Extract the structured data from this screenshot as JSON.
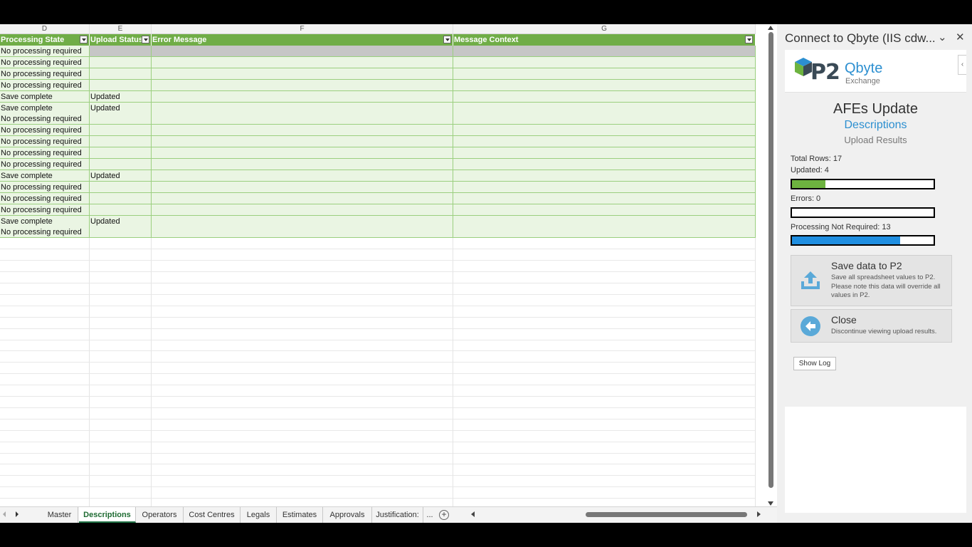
{
  "columns": [
    {
      "letter": "D",
      "header": "Processing State"
    },
    {
      "letter": "E",
      "header": "Upload Status"
    },
    {
      "letter": "F",
      "header": "Error Message"
    },
    {
      "letter": "G",
      "header": "Message Context"
    }
  ],
  "rows": [
    [
      "No processing required",
      ""
    ],
    [
      "No processing required",
      ""
    ],
    [
      "No processing required",
      ""
    ],
    [
      "No processing required",
      ""
    ],
    [
      "Save complete",
      "Updated"
    ],
    [
      "Save complete",
      "Updated"
    ],
    [
      "No processing required",
      ""
    ],
    [
      "No processing required",
      ""
    ],
    [
      "No processing required",
      ""
    ],
    [
      "No processing required",
      ""
    ],
    [
      "No processing required",
      ""
    ],
    [
      "Save complete",
      "Updated"
    ],
    [
      "No processing required",
      ""
    ],
    [
      "No processing required",
      ""
    ],
    [
      "No processing required",
      ""
    ],
    [
      "Save complete",
      "Updated"
    ],
    [
      "No processing required",
      ""
    ]
  ],
  "tabs": [
    "Master",
    "Descriptions",
    "Operators",
    "Cost Centres",
    "Legals",
    "Estimates",
    "Approvals",
    "Justification:",
    "..."
  ],
  "active_tab": "Descriptions",
  "pane": {
    "title": "Connect to Qbyte (IIS cdw...",
    "logo_p2": "P2",
    "logo_qbyte": "Qbyte",
    "logo_exchange": "Exchange",
    "heading": "AFEs Update",
    "subheading": "Descriptions",
    "section": "Upload Results",
    "total_rows": "Total Rows: 17",
    "updated": "Updated: 4",
    "updated_fraction": 0.235,
    "errors": "Errors: 0",
    "errors_fraction": 0,
    "not_required": "Processing Not Required: 13",
    "not_required_fraction": 0.765,
    "save_title": "Save data to P2",
    "save_desc": "Save all spreadsheet values to P2. Please note this data will override all values in P2.",
    "close_title": "Close",
    "close_desc": "Discontinue viewing upload results.",
    "show_log": "Show Log"
  },
  "colors": {
    "header_green": "#70ad47",
    "updated_bar": "#6db33f",
    "not_required_bar": "#1f8ee0",
    "accent_blue": "#2c8fd0"
  }
}
